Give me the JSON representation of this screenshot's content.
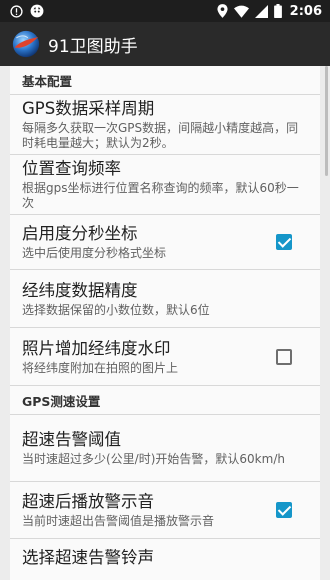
{
  "status_bar": {
    "time": "2:06"
  },
  "app_bar": {
    "title": "91卫图助手"
  },
  "sections": [
    {
      "header": "基本配置",
      "items": [
        {
          "title": "GPS数据采样周期",
          "summary": "每隔多久获取一次GPS数据，间隔越小精度越高，同时耗电量越大；默认为2秒。",
          "checkbox": null
        },
        {
          "title": "位置查询频率",
          "summary": "根据gps坐标进行位置名称查询的频率，默认60秒一次",
          "checkbox": null
        },
        {
          "title": "启用度分秒坐标",
          "summary": "选中后使用度分秒格式坐标",
          "checkbox": true
        },
        {
          "title": "经纬度数据精度",
          "summary": "选择数据保留的小数位数，默认6位",
          "checkbox": null
        },
        {
          "title": "照片增加经纬度水印",
          "summary": "将经纬度附加在拍照的图片上",
          "checkbox": false
        }
      ]
    },
    {
      "header": "GPS测速设置",
      "items": [
        {
          "title": "超速告警阈值",
          "summary": "当时速超过多少(公里/时)开始告警，默认60km/h",
          "checkbox": null
        },
        {
          "title": "超速后播放警示音",
          "summary": "当前时速超出告警阈值是播放警示音",
          "checkbox": true
        },
        {
          "title": "选择超速告警铃声",
          "summary": "",
          "checkbox": null
        }
      ]
    }
  ],
  "colors": {
    "accent": "#1596c9",
    "appbar": "#2a2a2a",
    "statusbar": "#1e1e1e"
  }
}
